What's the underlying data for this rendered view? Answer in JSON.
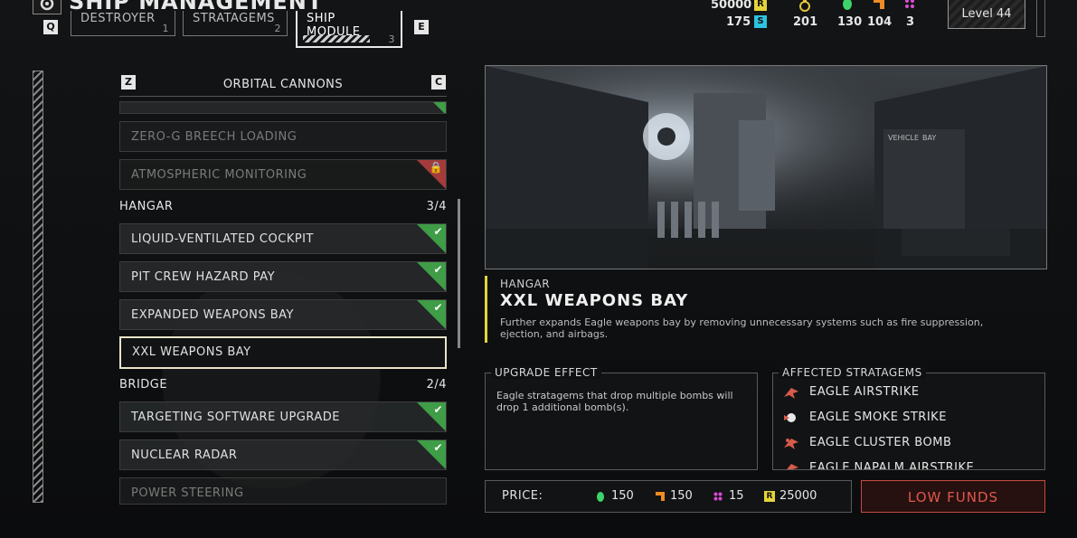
{
  "header": {
    "title": "SHIP MANAGEMENT",
    "tab_prev_key": "Q",
    "tab_next_key": "E",
    "tabs": [
      {
        "label": "DESTROYER",
        "num": "1"
      },
      {
        "label": "STRATAGEMS",
        "num": "2"
      },
      {
        "label": "SHIP MODULE",
        "num": "3",
        "active": true
      }
    ],
    "resources": {
      "req": "50000",
      "sc": "175",
      "medals": "201",
      "common": "130",
      "rare": "104",
      "super_rare": "3"
    },
    "level": "Level 44"
  },
  "list": {
    "prev_key": "Z",
    "next_key": "C",
    "category": "ORBITAL CANNONS",
    "orbital_items": [
      {
        "label": "ZERO-G BREECH LOADING",
        "state": "locked-dim"
      },
      {
        "label": "ATMOSPHERIC MONITORING",
        "state": "locked"
      }
    ],
    "hangar": {
      "label": "HANGAR",
      "count": "3/4",
      "items": [
        {
          "label": "LIQUID-VENTILATED COCKPIT",
          "state": "owned"
        },
        {
          "label": "PIT CREW HAZARD PAY",
          "state": "owned"
        },
        {
          "label": "EXPANDED WEAPONS BAY",
          "state": "owned"
        },
        {
          "label": "XXL WEAPONS BAY",
          "state": "selected"
        }
      ]
    },
    "bridge": {
      "label": "BRIDGE",
      "count": "2/4",
      "items": [
        {
          "label": "TARGETING SOFTWARE UPGRADE",
          "state": "owned"
        },
        {
          "label": "NUCLEAR RADAR",
          "state": "owned"
        },
        {
          "label": "POWER STEERING",
          "state": "dim"
        }
      ]
    }
  },
  "detail": {
    "category": "HANGAR",
    "title": "XXL WEAPONS BAY",
    "description": "Further expands Eagle weapons bay by removing unnecessary systems such as fire suppression, ejection, and airbags.",
    "image_labels": {
      "vehicle": "VEHICLE",
      "bay": "BAY"
    }
  },
  "effect": {
    "title": "UPGRADE EFFECT",
    "text": "Eagle stratagems that drop multiple bombs will drop 1 additional bomb(s)."
  },
  "stratagems": {
    "title": "AFFECTED STRATAGEMS",
    "items": [
      "EAGLE AIRSTRIKE",
      "EAGLE SMOKE STRIKE",
      "EAGLE CLUSTER BOMB",
      "EAGLE NAPALM AIRSTRIKE"
    ]
  },
  "price": {
    "label": "PRICE:",
    "common": "150",
    "rare": "150",
    "super_rare": "15",
    "req": "25000"
  },
  "action": {
    "label": "LOW FUNDS"
  },
  "colors": {
    "accent_yellow": "#e4d33a",
    "owned_green": "#3f9c47",
    "locked_red": "#a43b3b",
    "common_green": "#3fd26a",
    "rare_orange": "#f08a24",
    "super_pink": "#d94ad1",
    "low_funds": "#e0584a"
  },
  "icons": {
    "gear": "gear-icon",
    "req": "requisition-icon",
    "sc": "super-credit-icon",
    "medal": "medal-icon",
    "check": "check-icon",
    "lock": "lock-icon",
    "eagle": "eagle-icon"
  }
}
